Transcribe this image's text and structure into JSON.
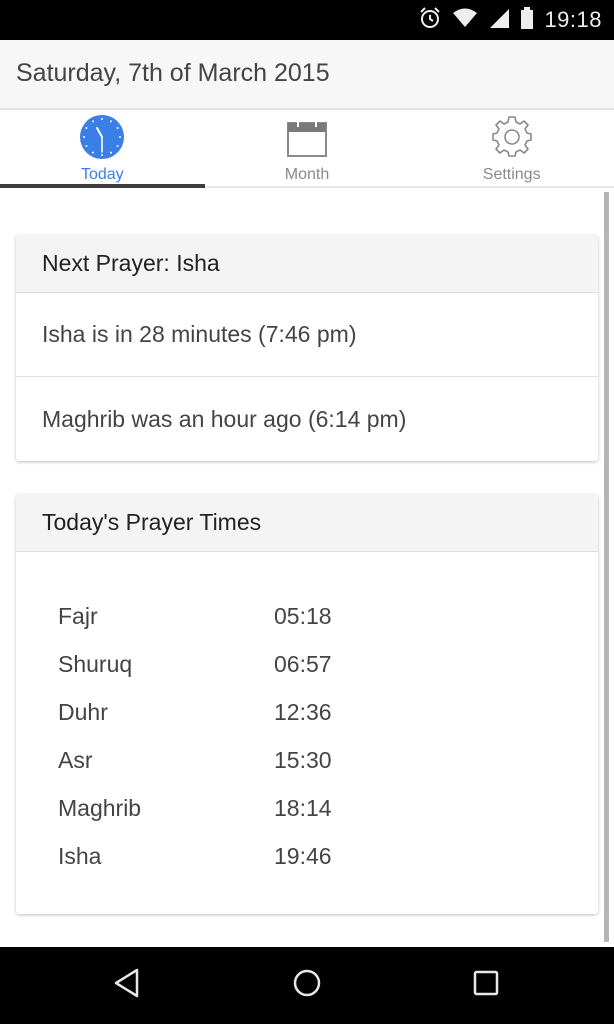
{
  "status_bar": {
    "time": "19:18",
    "icons": [
      "alarm-icon",
      "wifi-icon",
      "cell-signal-icon",
      "battery-icon"
    ]
  },
  "header": {
    "date_title": "Saturday, 7th of March 2015"
  },
  "tabs": [
    {
      "label": "Today",
      "icon": "clock-icon",
      "active": true
    },
    {
      "label": "Month",
      "icon": "calendar-icon",
      "active": false
    },
    {
      "label": "Settings",
      "icon": "gear-icon",
      "active": false
    }
  ],
  "colors": {
    "accent": "#3a7ee8",
    "tab_indicator": "#3c3c3c",
    "card_header_bg": "#f4f4f4"
  },
  "next_prayer_card": {
    "title": "Next Prayer: Isha",
    "rows": [
      "Isha is in 28 minutes (7:46 pm)",
      "Maghrib was an hour ago (6:14 pm)"
    ]
  },
  "prayer_times_card": {
    "title": "Today's Prayer Times",
    "times": [
      {
        "name": "Fajr",
        "time": "05:18"
      },
      {
        "name": "Shuruq",
        "time": "06:57"
      },
      {
        "name": "Duhr",
        "time": "12:36"
      },
      {
        "name": "Asr",
        "time": "15:30"
      },
      {
        "name": "Maghrib",
        "time": "18:14"
      },
      {
        "name": "Isha",
        "time": "19:46"
      }
    ]
  },
  "nav_bar": {
    "buttons": [
      "back",
      "home",
      "recents"
    ]
  }
}
